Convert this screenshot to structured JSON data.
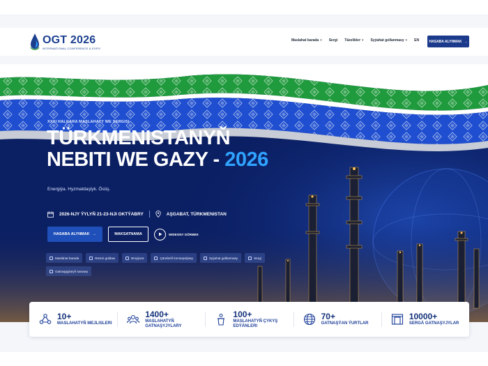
{
  "logo": {
    "title": "OGT 2026",
    "subtitle": "INTERNATIONAL CONFERENCE & EXPO",
    "icon": "oil-drop-icon"
  },
  "nav": {
    "items": [
      {
        "label": "Maslahat barada",
        "has_caret": true
      },
      {
        "label": "Sergi",
        "has_caret": false
      },
      {
        "label": "Täzelikler",
        "has_caret": true
      },
      {
        "label": "Syýahat gollanmasy",
        "has_caret": true
      },
      {
        "label": "EN",
        "has_caret": false
      }
    ],
    "cta_label": "HASABA ALYNMAK"
  },
  "hero": {
    "eyebrow": "XXXI HALKARA MASLAHATY WE SERGISI",
    "title_line1": "TÜRKMENISTANYŇ",
    "title_line2": "NEBITI WE GAZY - ",
    "title_year": "2026",
    "tagline": "Energiýa. Hyzmatdaşlyk. Ösüş.",
    "date": "2026-NJY ÝYLYŇ 21-23-NJI OKTÝABRY",
    "location": "AŞGABAT, TÜRKMENISTAN",
    "primary_button": "HASABA ALYNMAK",
    "secondary_button": "MAKSATNAMA",
    "video_label": "WIDEONY GÖRMEK",
    "chips": [
      "Maslahat barada",
      "Resmi goldaw",
      "Broşýura",
      "Çäreleriň konsepsiýasy",
      "Syýahat gollanmasy",
      "Sergi",
      "Gatnaşyjylaryň sanawy"
    ]
  },
  "stats": [
    {
      "number": "10+",
      "label_line1": "MASLAHATYŇ MEJLISLERI",
      "label_line2": "",
      "icon": "network-icon"
    },
    {
      "number": "1400+",
      "label_line1": "MASLAHATYŇ",
      "label_line2": "GATNAŞYJYLARY",
      "icon": "people-icon"
    },
    {
      "number": "100+",
      "label_line1": "MASLAHATYŇ ÇYKYŞ",
      "label_line2": "EDÝÄNLERI",
      "icon": "podium-icon"
    },
    {
      "number": "70+",
      "label_line1": "GATNAŞÝAN ÝURTLAR",
      "label_line2": "",
      "icon": "globe-icon"
    },
    {
      "number": "10000+",
      "label_line1": "SERGÄ GATNAŞYJYLAR",
      "label_line2": "",
      "icon": "gate-icon"
    }
  ],
  "colors": {
    "primary": "#1b3a8c",
    "accent": "#2fa3ff",
    "green": "#1f9a3c",
    "hero_bg": "#0b1f63"
  }
}
